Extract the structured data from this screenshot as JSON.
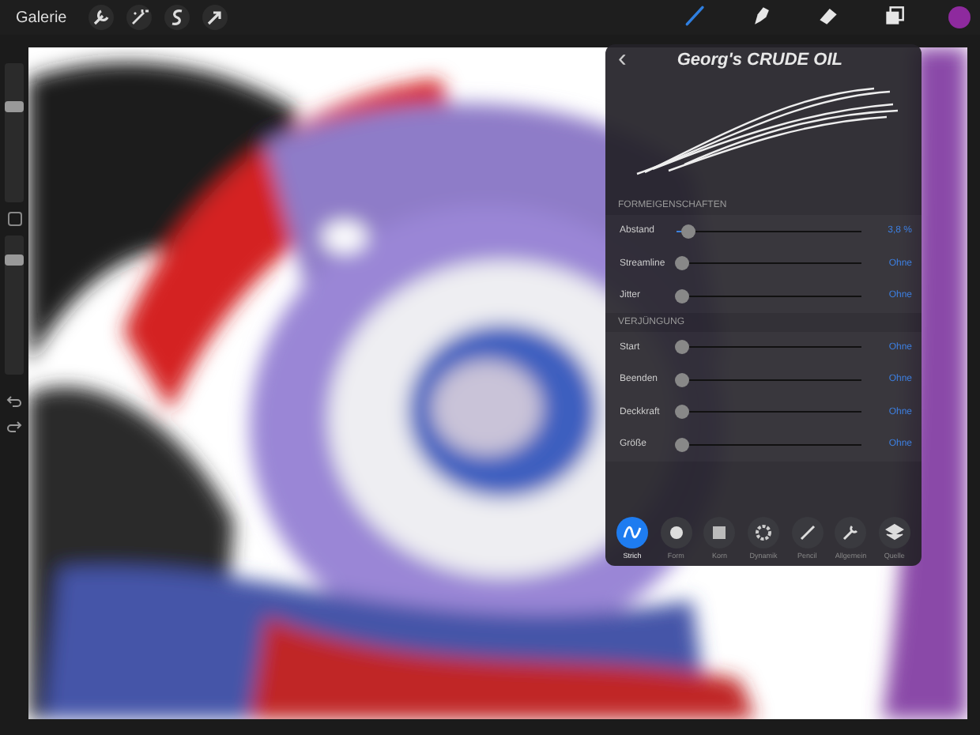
{
  "top_bar": {
    "gallery": "Galerie",
    "actions": [
      {
        "kind": "wrench"
      },
      {
        "kind": "wand"
      },
      {
        "kind": "s"
      },
      {
        "kind": "arrow"
      }
    ],
    "tools": [
      {
        "kind": "brush",
        "selected": true
      },
      {
        "kind": "smudge",
        "selected": false
      },
      {
        "kind": "eraser",
        "selected": false
      },
      {
        "kind": "layers",
        "selected": false
      }
    ],
    "color": "#8e2a9e"
  },
  "sidebar": {
    "size_slider": {
      "level": 0.7
    },
    "opacity_slider": {
      "level": 0.85
    }
  },
  "brush_panel": {
    "title": "Georg's CRUDE OIL",
    "back": "‹",
    "sections": [
      {
        "heading": "FORMEIGENSCHAFTEN",
        "rows": [
          {
            "label": "Abstand",
            "level": 0.03,
            "value": "3,8 %"
          },
          {
            "label": "Streamline",
            "level": 0,
            "value": "Ohne"
          },
          {
            "label": "Jitter",
            "level": 0,
            "value": "Ohne"
          }
        ]
      },
      {
        "heading": "VERJÜNGUNG",
        "rows": [
          {
            "label": "Start",
            "level": 0,
            "value": "Ohne"
          },
          {
            "label": "Beenden",
            "level": 0,
            "value": "Ohne"
          },
          {
            "label": "Deckkraft",
            "level": 0,
            "value": "Ohne"
          },
          {
            "label": "Größe",
            "level": 0,
            "value": "Ohne"
          }
        ]
      }
    ],
    "tabs": [
      {
        "label": "Strich",
        "kind": "stroke",
        "selected": true
      },
      {
        "label": "Form",
        "kind": "shape",
        "selected": false
      },
      {
        "label": "Korn",
        "kind": "grain",
        "selected": false
      },
      {
        "label": "Dynamik",
        "kind": "dynamics",
        "selected": false
      },
      {
        "label": "Pencil",
        "kind": "pencil",
        "selected": false
      },
      {
        "label": "Allgemein",
        "kind": "general",
        "selected": false
      },
      {
        "label": "Quelle",
        "kind": "source",
        "selected": false
      }
    ]
  }
}
